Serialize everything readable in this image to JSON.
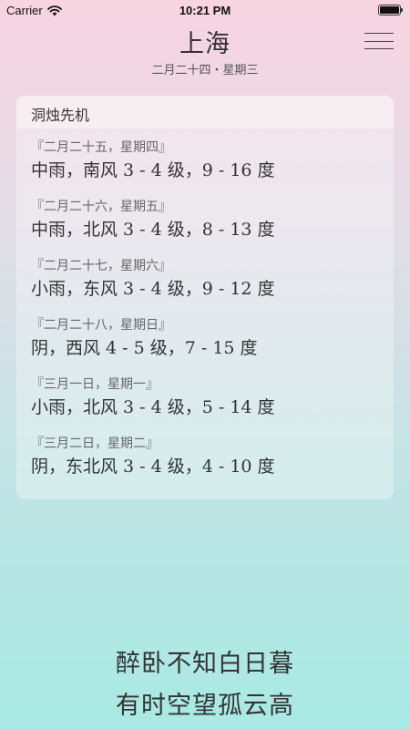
{
  "status_bar": {
    "carrier": "Carrier",
    "time": "10:21 PM"
  },
  "header": {
    "city": "上海",
    "date": "二月二十四・星期三"
  },
  "card": {
    "title": "洞烛先机",
    "days": [
      {
        "date": "『二月二十五，星期四』",
        "weather": "中雨，南风 3 - 4 级，9 - 16 度"
      },
      {
        "date": "『二月二十六，星期五』",
        "weather": "中雨，北风 3 - 4 级，8 - 13 度"
      },
      {
        "date": "『二月二十七，星期六』",
        "weather": "小雨，东风 3 - 4 级，9 - 12 度"
      },
      {
        "date": "『二月二十八，星期日』",
        "weather": "阴，西风 4 - 5 级，7 - 15 度"
      },
      {
        "date": "『三月一日，星期一』",
        "weather": "小雨，北风 3 - 4 级，5 - 14 度"
      },
      {
        "date": "『三月二日，星期二』",
        "weather": "阴，东北风 3 - 4 级，4 - 10 度"
      }
    ]
  },
  "poem": {
    "line1": "醉卧不知白日暮",
    "line2": "有时空望孤云高"
  },
  "icons": {
    "wifi": "wifi-icon",
    "battery": "battery-icon",
    "menu": "hamburger-menu-icon"
  }
}
